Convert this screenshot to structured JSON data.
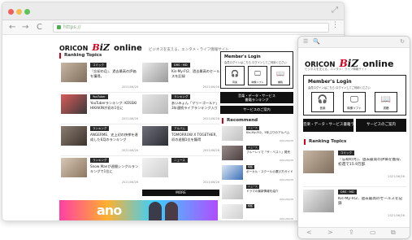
{
  "desktop": {
    "window_controls": {
      "close": "close-dot",
      "minimize": "minimize-dot",
      "zoom": "zoom-dot"
    },
    "nav": {
      "back": "←",
      "forward": "→",
      "reload": "C",
      "more": "⋮",
      "expand": "⤢"
    },
    "url": "https://",
    "logo": {
      "oricon": "ORICON",
      "biz_b": "B",
      "biz_rest": "iZ",
      "online": "online",
      "tagline": "ビジネスを支える、エンタメ・ライフ情報サイト"
    },
    "ranking_title": "Ranking Topics",
    "cards": [
      {
        "tag": "コミック",
        "title": "『忘却の月』、過去最高の評価を獲得。",
        "date": "2021/06/26"
      },
      {
        "tag": "DRS・MD",
        "title": "Kis-My-Ft2、過去最高のセールスを記録",
        "date": "2021/06/26"
      },
      {
        "tag": "YouTuber",
        "title": "YouTuberランキング: KOSSKI HIKAKINが初の1位に",
        "date": "2021/06/26"
      },
      {
        "tag": "ランキング",
        "title": "あいみょん「マリーゴールド」3年連続ライブランキング入り",
        "date": "2021/06/26"
      },
      {
        "tag": "ランキング",
        "title": "ANGERME、史上初の快挙を達成した6月のランキング",
        "date": "2021/06/26"
      },
      {
        "tag": "アルバム",
        "title": "TOMORROW X TOGETHER、初の週間1位を獲得",
        "date": "2021/06/26"
      },
      {
        "tag": "ランキング",
        "title": "Snow Manが週間シングルランキングで1位に",
        "date": "2021/06/26"
      },
      {
        "tag": "ニュース",
        "title": "",
        "date": "2021/06/26"
      }
    ],
    "login": {
      "title": "Member's Login",
      "subtitle": "会員ログインはこちら ログインしてご利用ください",
      "icons": [
        {
          "glyph": "🎧",
          "label": "音楽"
        },
        {
          "glyph": "🖵",
          "label": "映像ソフト"
        },
        {
          "glyph": "📖",
          "label": "書籍"
        }
      ]
    },
    "btn_data": "音楽・データ・サービス\n書籍ランキング",
    "btn_service": "サービスのご案内",
    "recommend_title": "Recommend",
    "rec_items": [
      {
        "tag": "ニュース",
        "title": "Kis-My-Ft2、5年ぶりのアルバム",
        "date": "2021/06/26"
      },
      {
        "tag": "ニュース",
        "title": "ブルーレイで「ザ・ベスト」発売",
        "date": "2021/06/26"
      },
      {
        "tag": "特集",
        "title": "ボーカル・スクールの選び方ガイド",
        "date": "2021/06/26"
      },
      {
        "tag": "ニュース",
        "title": "ドラマの最新情報を紹介",
        "date": "2021/06/26"
      },
      {
        "tag": "特集",
        "title": "",
        "date": "2021/06/26"
      }
    ],
    "more_button": "MORE",
    "banner_text": "ano"
  },
  "mobile": {
    "top_icons": [
      "☰",
      "🔍",
      "↻"
    ],
    "logo": {
      "oricon": "ORICON",
      "biz_b": "B",
      "biz_rest": "iZ",
      "online": "online",
      "tagline": "ビジネスを支える、エンタメ・ライフ情報サイト"
    },
    "login": {
      "title": "Member's Login",
      "subtitle": "会員ログインはこちら ログインしてご利用ください",
      "icons": [
        {
          "glyph": "🎧",
          "label": "音楽"
        },
        {
          "glyph": "🖵",
          "label": "映像ソフト"
        },
        {
          "glyph": "📖",
          "label": "書籍"
        }
      ]
    },
    "btn_data": "音楽・データ・サービス書籍ランキング",
    "btn_service": "サービスのご案内",
    "ranking_title": "Ranking Topics",
    "items": [
      {
        "tag": "コミック",
        "title": "『忘却の月』、過去最高の評価を獲得、初週で15.9万部",
        "date": "2021/06/26"
      },
      {
        "tag": "DRS・MD",
        "title": "Kis-My-Ft2、過去最高のセールスを記録",
        "date": "2021/06/26"
      }
    ],
    "bottom_icons": [
      "<",
      ">",
      "⇪",
      "▭",
      "⧉"
    ]
  }
}
